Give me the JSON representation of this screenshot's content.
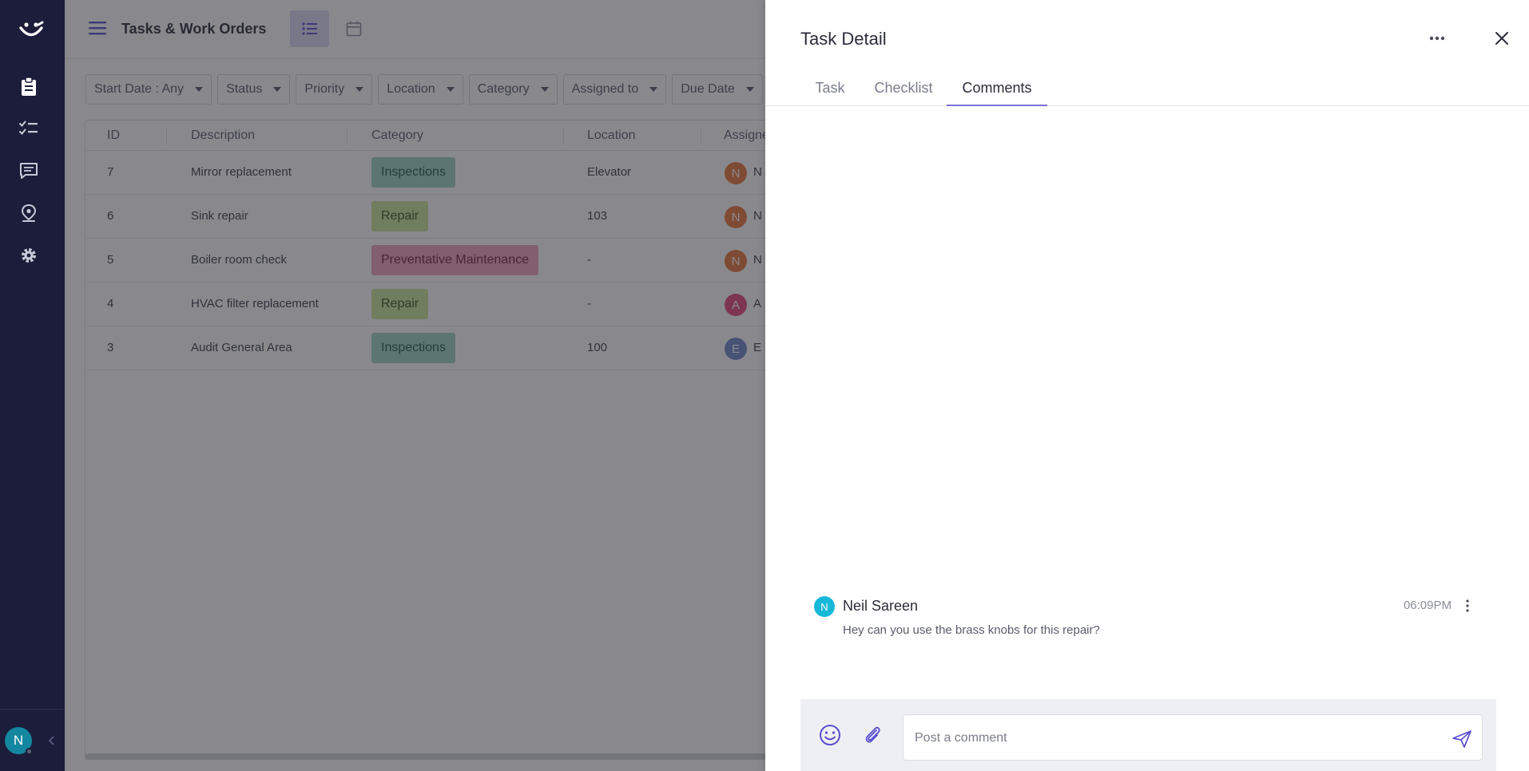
{
  "app": {
    "page_title": "Tasks & Work Orders",
    "user_initial": "N"
  },
  "filters": [
    {
      "label": "Start Date : Any"
    },
    {
      "label": "Status"
    },
    {
      "label": "Priority"
    },
    {
      "label": "Location"
    },
    {
      "label": "Category"
    },
    {
      "label": "Assigned to"
    },
    {
      "label": "Due Date"
    }
  ],
  "table": {
    "columns": [
      "ID",
      "Description",
      "Category",
      "Location",
      "Assigne"
    ],
    "rows": [
      {
        "id": "7",
        "description": "Mirror replacement",
        "category": "Inspections",
        "category_kind": "inspect",
        "location": "Elevator",
        "assignee_initial": "N",
        "assignee_color": "#e8753a",
        "assignee_name": "N"
      },
      {
        "id": "6",
        "description": "Sink repair",
        "category": "Repair",
        "category_kind": "repair",
        "location": "103",
        "assignee_initial": "N",
        "assignee_color": "#e8753a",
        "assignee_name": "N"
      },
      {
        "id": "5",
        "description": "Boiler room check",
        "category": "Preventative Maintenance",
        "category_kind": "prevent",
        "location": "-",
        "assignee_initial": "N",
        "assignee_color": "#e8753a",
        "assignee_name": "N"
      },
      {
        "id": "4",
        "description": "HVAC filter replacement",
        "category": "Repair",
        "category_kind": "repair",
        "location": "-",
        "assignee_initial": "A",
        "assignee_color": "#e4457a",
        "assignee_name": "A"
      },
      {
        "id": "3",
        "description": "Audit General Area",
        "category": "Inspections",
        "category_kind": "inspect",
        "location": "100",
        "assignee_initial": "E",
        "assignee_color": "#6e86c9",
        "assignee_name": "E"
      }
    ]
  },
  "panel": {
    "title": "Task Detail",
    "tabs": [
      {
        "label": "Task",
        "active": false
      },
      {
        "label": "Checklist",
        "active": false
      },
      {
        "label": "Comments",
        "active": true
      }
    ],
    "comments": [
      {
        "initial": "N",
        "author": "Neil Sareen",
        "time": "06:09PM",
        "text": "Hey can you use the brass knobs for this repair?"
      }
    ],
    "composer": {
      "placeholder": "Post a comment",
      "value": ""
    }
  },
  "colors": {
    "nav_bg": "#1b1d3a",
    "accent": "#7d72d6",
    "comment_avatar": "#16b8d8"
  },
  "icons": {
    "nav": [
      "logo-icon",
      "clipboard-icon",
      "checklist-icon",
      "chat-icon",
      "location-pin-icon",
      "gear-icon"
    ],
    "panel": [
      "more-horizontal-icon",
      "close-icon",
      "emoji-icon",
      "paperclip-icon",
      "send-icon"
    ]
  }
}
